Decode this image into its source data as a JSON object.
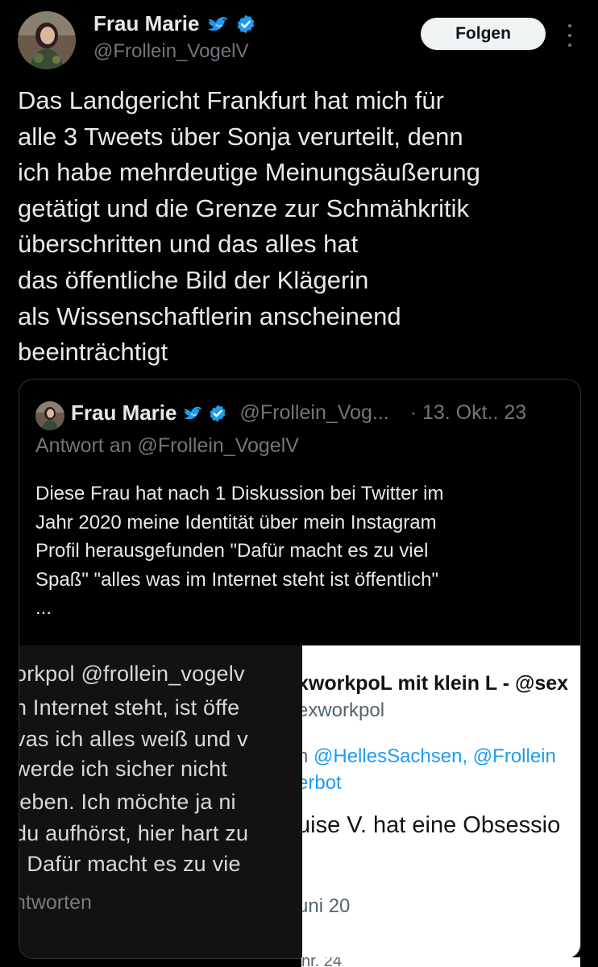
{
  "header": {
    "name": "Frau Marie",
    "handle": "@Frollein_VogelV",
    "follow_label": "Folgen"
  },
  "tweet": {
    "text": "Das Landgericht Frankfurt hat mich für\nalle 3 Tweets über Sonja verurteilt, denn\nich habe mehrdeutige Meinungsäußerung\ngetätigt und die Grenze zur Schmähkritik\nüberschritten und das alles hat\ndas  öffentliche Bild der Klägerin\nals Wissenschaftlerin anscheinend\nbeeinträchtigt"
  },
  "quoted": {
    "name": "Frau Marie",
    "handle": "@Frollein_Vog...",
    "date": "· 13. Okt.. 23",
    "reply_to": "Antwort an @Frollein_VogelV",
    "text": "Diese Frau hat nach 1 Diskussion bei Twitter im\nJahr 2020 meine Identität über mein Instagram\nProfil herausgefunden \"Dafür macht es zu viel\nSpaß\" \"alles was im Internet steht ist öffentlich\"\n..."
  },
  "media": {
    "dark_lines": [
      "orkpol @frollein_vogelv",
      "n Internet steht, ist öffe",
      "vas ich alles weiß und v",
      " werde ich sicher nicht",
      "jeben. Ich möchte ja ni",
      "du aufhörst, hier hart zu",
      ". Dafür macht es zu vie"
    ],
    "dark_footer": "ntworten",
    "light_title": "xworkpoL mit klein L - @sex",
    "light_handle": "exworkpol",
    "light_reply_prefix": "n ",
    "light_reply_links": "@HellesSachsen, @Frollein",
    "light_reply_line2": "erbot",
    "light_body": "uise V. hat eine Obsessio",
    "light_date": "uni 20",
    "light_cut": "hr. 24"
  },
  "colors": {
    "background": "#000000",
    "text": "#e7e9ea",
    "muted": "#71767b",
    "verified": "#1d9bf0",
    "bird": "#1d9bf0"
  },
  "icons": {
    "bird": "bird-emoji-icon",
    "verified": "verified-badge-icon",
    "more": "more-options-icon"
  }
}
